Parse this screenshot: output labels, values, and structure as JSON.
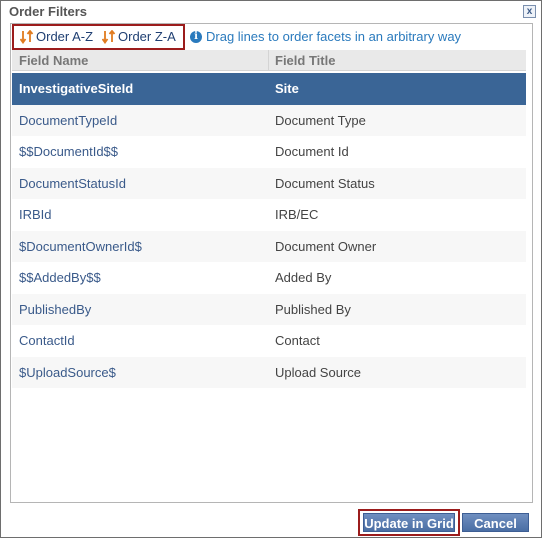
{
  "dialog": {
    "title": "Order Filters",
    "close_label": "x"
  },
  "toolbar": {
    "order_az_label": "Order A-Z",
    "order_za_label": "Order Z-A",
    "hint_text": "Drag lines to order facets in an arbitrary way"
  },
  "grid": {
    "headers": {
      "field_name": "Field Name",
      "field_title": "Field Title"
    },
    "rows": [
      {
        "name": "InvestigativeSiteId",
        "title": "Site"
      },
      {
        "name": "DocumentTypeId",
        "title": "Document Type"
      },
      {
        "name": "$$DocumentId$$",
        "title": "Document Id"
      },
      {
        "name": "DocumentStatusId",
        "title": "Document Status"
      },
      {
        "name": "IRBId",
        "title": "IRB/EC"
      },
      {
        "name": "$DocumentOwnerId$",
        "title": "Document Owner"
      },
      {
        "name": "$$AddedBy$$",
        "title": "Added By"
      },
      {
        "name": "PublishedBy",
        "title": "Published By"
      },
      {
        "name": "ContactId",
        "title": "Contact"
      },
      {
        "name": "$UploadSource$",
        "title": "Upload Source"
      }
    ],
    "selected_index": 0
  },
  "footer": {
    "update_label": "Update in Grid",
    "cancel_label": "Cancel"
  },
  "colors": {
    "selected_row": "#3a6596",
    "highlight_border": "#9b1c1c",
    "link": "#2a7abd",
    "sort_arrow": "#e07b1f"
  },
  "icons": [
    "sort-ascending-icon",
    "sort-descending-icon",
    "info-icon",
    "close-icon"
  ]
}
